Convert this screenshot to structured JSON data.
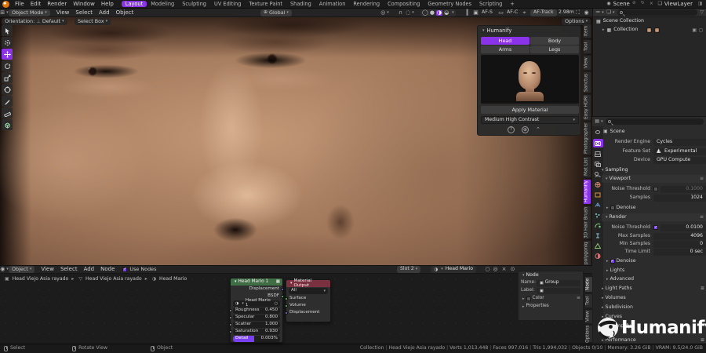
{
  "topbar": {
    "menus": [
      {
        "label": "File"
      },
      {
        "label": "Edit"
      },
      {
        "label": "Render"
      },
      {
        "label": "Window"
      },
      {
        "label": "Help"
      }
    ],
    "workspaces": [
      {
        "label": "Layout"
      },
      {
        "label": "Modeling"
      },
      {
        "label": "Sculpting"
      },
      {
        "label": "UV Editing"
      },
      {
        "label": "Texture Paint"
      },
      {
        "label": "Shading"
      },
      {
        "label": "Animation"
      },
      {
        "label": "Rendering"
      },
      {
        "label": "Compositing"
      },
      {
        "label": "Geometry Nodes"
      },
      {
        "label": "Scripting"
      }
    ],
    "add_workspace": "+",
    "scene_name": "Scene",
    "viewlayer_name": "ViewLayer"
  },
  "viewport": {
    "header": {
      "mode": "Object Mode",
      "menus": [
        {
          "label": "View"
        },
        {
          "label": "Select"
        },
        {
          "label": "Add"
        },
        {
          "label": "Object"
        }
      ],
      "transform_orientation": "Global",
      "af_s": "AF-S",
      "af_c": "AF-C",
      "af_track": "AF-Track",
      "focus_distance": "2.98m",
      "options_label": "Options"
    },
    "tool_settings": {
      "orientation_label": "Orientation:",
      "orientation_value": "Default",
      "active_tool": "Select Box"
    }
  },
  "humanify_panel": {
    "title": "Humanify",
    "body_parts": [
      {
        "label": "Head"
      },
      {
        "label": "Body"
      },
      {
        "label": "Arms"
      },
      {
        "label": "Legs"
      }
    ],
    "apply_button": "Apply Material",
    "preset": "Medium High Contrast"
  },
  "sidebar_tabs": [
    {
      "label": "Item"
    },
    {
      "label": "Tool"
    },
    {
      "label": "View"
    },
    {
      "label": "Sanctus"
    },
    {
      "label": "Easy HDRI"
    },
    {
      "label": "Photographer"
    },
    {
      "label": "Mat List"
    },
    {
      "label": "Humanify"
    },
    {
      "label": "3D Hair Brush"
    },
    {
      "label": "polygoniq"
    }
  ],
  "outliner": {
    "root": "Scene Collection",
    "collection": "Collection"
  },
  "properties": {
    "nav_label": "Scene",
    "render_engine_label": "Render Engine",
    "render_engine": "Cycles",
    "feature_set_label": "Feature Set",
    "feature_set": "Experimental",
    "device_label": "Device",
    "device": "GPU Compute",
    "sampling_section": "Sampling",
    "viewport_section": "Viewport",
    "noise_threshold_label": "Noise Threshold",
    "viewport_noise_threshold": "0.1000",
    "samples_label": "Samples",
    "viewport_samples": "1024",
    "denoise_label": "Denoise",
    "render_section": "Render",
    "render_noise_threshold": "0.0100",
    "max_samples_label": "Max Samples",
    "max_samples": "4096",
    "min_samples_label": "Min Samples",
    "min_samples": "0",
    "time_limit_label": "Time Limit",
    "time_limit": "0 sec",
    "lights_section": "Lights",
    "advanced_section": "Advanced",
    "light_paths_section": "Light Paths",
    "volumes_section": "Volumes",
    "subdivision_section": "Subdivision",
    "curves_section": "Curves",
    "simplify_section": "Simplify",
    "performance_section": "Performance"
  },
  "shader": {
    "header": {
      "mode": "Object",
      "menus": [
        {
          "label": "View"
        },
        {
          "label": "Select"
        },
        {
          "label": "Add"
        },
        {
          "label": "Node"
        }
      ],
      "use_nodes": "Use Nodes",
      "slot": "Slot 2",
      "material": "Head Mario"
    },
    "breadcrumb": [
      {
        "label": "Head Viejo Asia rayado"
      },
      {
        "label": "Head Viejo Asia rayado"
      },
      {
        "label": "Head Mario"
      }
    ],
    "group_node": {
      "title": "Head Mario 1",
      "outputs": [
        {
          "label": "Displacement"
        },
        {
          "label": "BSDF"
        }
      ],
      "datablock": "Head Mario 1",
      "params": [
        {
          "label": "Roughness",
          "value": "0.450"
        },
        {
          "label": "Specular",
          "value": "0.800"
        },
        {
          "label": "Scatter",
          "value": "1.000"
        },
        {
          "label": "Saturation",
          "value": "0.930"
        },
        {
          "label": "Detail",
          "value": "0.003%"
        }
      ]
    },
    "output_node": {
      "title": "Material Output",
      "target": "All",
      "inputs": [
        {
          "label": "Surface"
        },
        {
          "label": "Volume"
        },
        {
          "label": "Displacement"
        }
      ]
    },
    "node_panel": {
      "title": "Node",
      "name_label": "Name:",
      "name_value": "Group",
      "label_label": "Label:",
      "color_label": "Color",
      "properties_label": "Properties",
      "tabs": [
        {
          "label": "Node"
        },
        {
          "label": "Tool"
        },
        {
          "label": "View"
        },
        {
          "label": "Options"
        }
      ]
    }
  },
  "statusbar": {
    "hints": [
      {
        "label": "Select"
      },
      {
        "label": "Rotate View"
      },
      {
        "label": "Object"
      }
    ],
    "stats": [
      {
        "label": "Collection"
      },
      {
        "label": "Head Viejo Asia rayado"
      },
      {
        "label": "Verts 1,013,448"
      },
      {
        "label": "Faces 997,016"
      },
      {
        "label": "Tris 1,994,032"
      },
      {
        "label": "Objects 0/10"
      },
      {
        "label": "Memory: 3.26 GiB"
      },
      {
        "label": "VRAM: 9.5/24.0 GiB"
      }
    ]
  },
  "watermark": {
    "brand": "Humanify"
  },
  "colors": {
    "accent": "#8b33e8",
    "group_node_header": "#3f6e44",
    "output_node_header": "#79303f"
  }
}
